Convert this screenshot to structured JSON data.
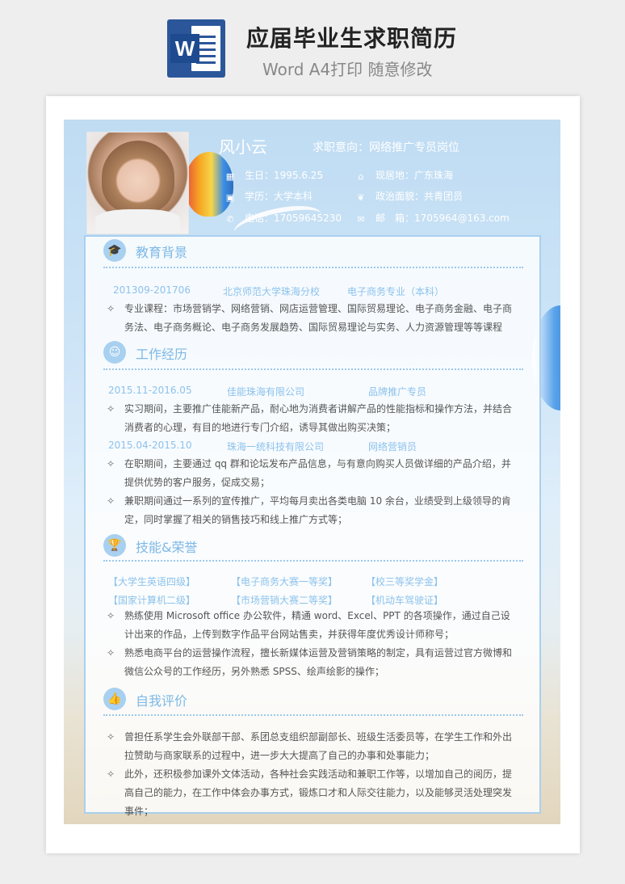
{
  "header": {
    "title": "应届毕业生求职简历",
    "subtitle": "Word A4打印 随意修改",
    "word_icon_letter": "W"
  },
  "profile": {
    "name": "风小云",
    "intent": "求职意向：网络推广专员岗位",
    "birth": "生日：1995.6.25",
    "residence": "现居地：广东珠海",
    "education": "学历：大学本科",
    "politics": "政治面貌：共青团员",
    "phone": "电话：17059645230",
    "email": "邮　箱：1705964@163.com"
  },
  "sections": {
    "education": {
      "title": "教育背景",
      "period": "201309-201706",
      "school": "北京师范大学珠海分校",
      "major": "电子商务专业（本科）",
      "bullets": [
        "专业课程：市场营销学、网络营销、网店运营管理、国际贸易理论、电子商务金融、电子商务法、电子商务概论、电子商务发展趋势、国际贸易理论与实务、人力资源管理等等课程"
      ]
    },
    "work": {
      "title": "工作经历",
      "jobs": [
        {
          "period": "2015.11-2016.05",
          "company": "佳能珠海有限公司",
          "role": "品牌推广专员",
          "bullets": [
            "实习期间，主要推广佳能新产品，耐心地为消费者讲解产品的性能指标和操作方法，并结合消费者的心理，有目的地进行专门介绍，诱导其做出购买决策；"
          ]
        },
        {
          "period": "2015.04-2015.10",
          "company": "珠海一统科技有限公司",
          "role": "网络营销员",
          "bullets": [
            "在职期间，主要通过 qq 群和论坛发布产品信息，与有意向购买人员做详细的产品介绍，并提供优势的客户服务，促成交易；",
            "兼职期间通过一系列的宣传推广，平均每月卖出各类电脑 10 余台，业绩受到上级领导的肯定，同时掌握了相关的销售技巧和线上推广方式等；"
          ]
        }
      ]
    },
    "skills": {
      "title": "技能&荣誉",
      "awards": [
        "【大学生英语四级】",
        "【电子商务大赛一等奖】",
        "【校三等奖学金】",
        "【国家计算机二级】",
        "【市场营销大赛二等奖】",
        "【机动车驾驶证】"
      ],
      "bullets": [
        "熟练使用 Microsoft office 办公软件，精通 word、Excel、PPT 的各项操作，通过自己设计出来的作品，上传到数字作品平台网站售卖，并获得年度优秀设计师称号；",
        "熟悉电商平台的运营操作流程，擅长新媒体运营及营销策略的制定，具有运营过官方微博和微信公众号的工作经历，另外熟悉 SPSS、绘声绘影的操作；"
      ]
    },
    "self": {
      "title": "自我评价",
      "bullets": [
        "曾担任系学生会外联部干部、系团总支组织部副部长、班级生活委员等，在学生工作和外出拉赞助与商家联系的过程中，进一步大大提高了自己的办事和处事能力；",
        "此外，还积极参加课外文体活动，各种社会实践活动和兼职工作等，以增加自己的阅历，提高自己的能力，在工作中体会办事方式，锻炼口才和人际交往能力，以及能够灵活处理突发事件；"
      ]
    }
  },
  "bullet_marker": "✧",
  "colors": {
    "accent": "#7db8e6",
    "card_border": "#a9d0ef",
    "word_blue": "#2b579a"
  }
}
